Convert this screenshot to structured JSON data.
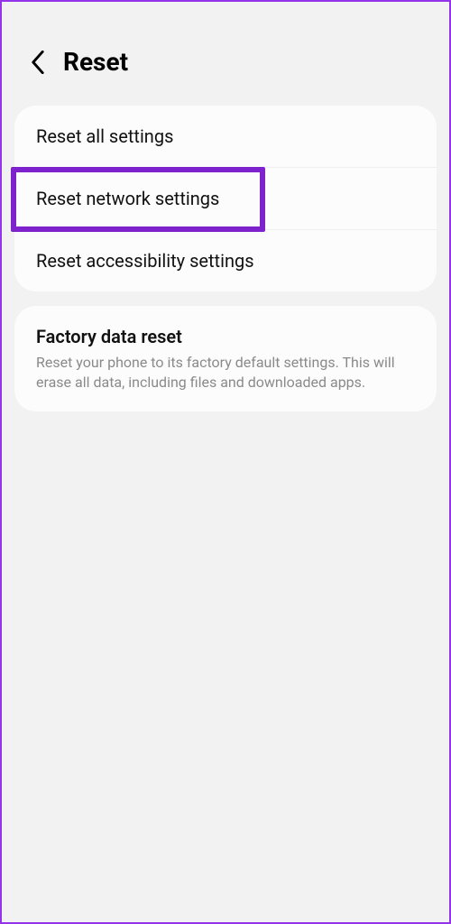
{
  "header": {
    "title": "Reset"
  },
  "group1": {
    "items": [
      {
        "label": "Reset all settings"
      },
      {
        "label": "Reset network settings"
      },
      {
        "label": "Reset accessibility settings"
      }
    ]
  },
  "group2": {
    "title": "Factory data reset",
    "description": "Reset your phone to its factory default settings. This will erase all data, including files and downloaded apps."
  }
}
